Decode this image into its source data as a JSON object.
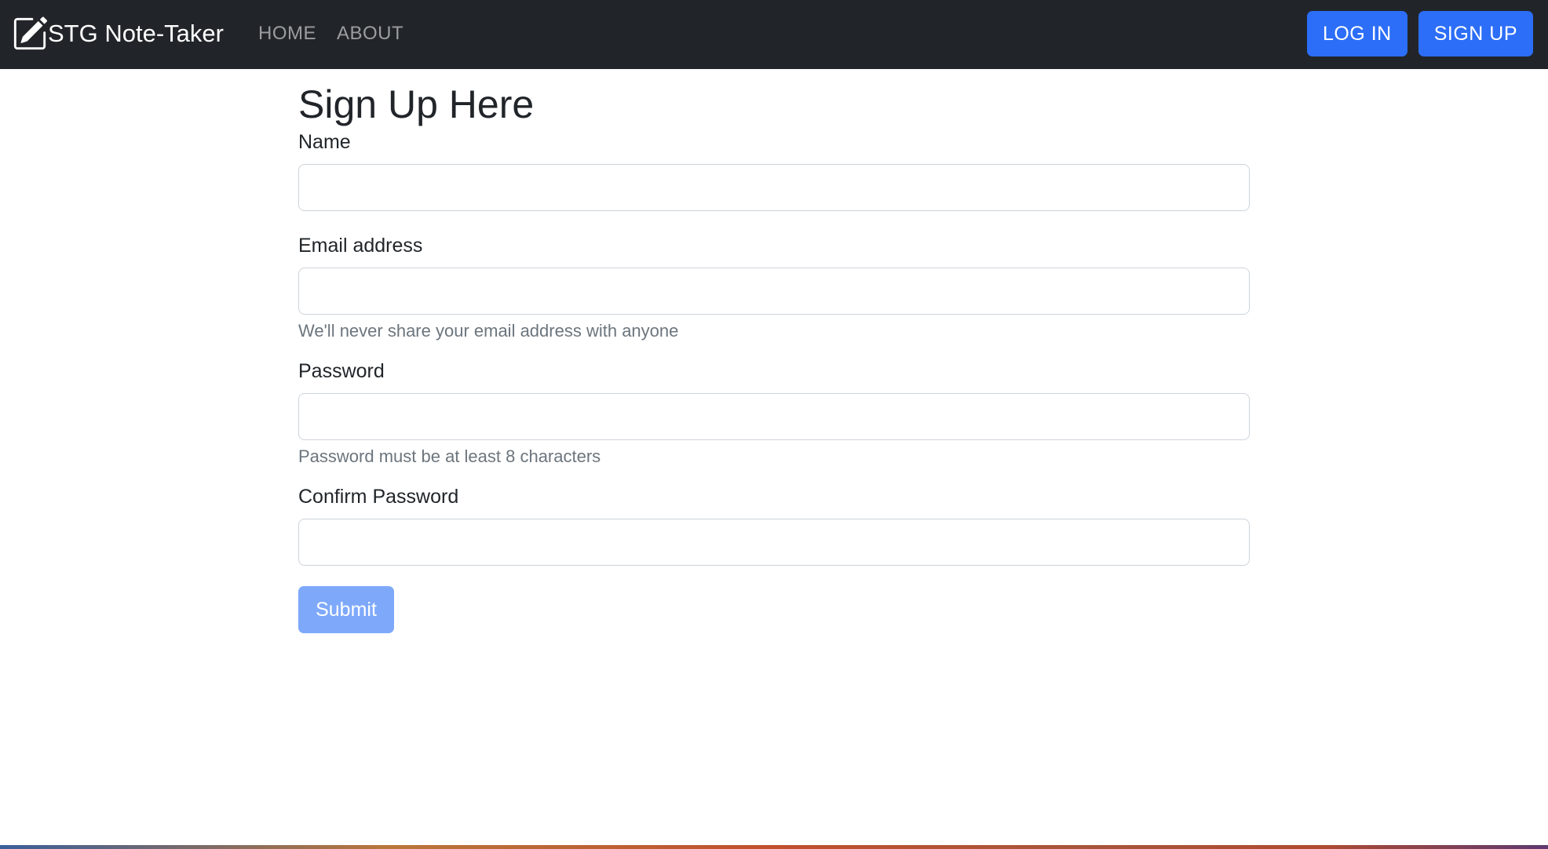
{
  "navbar": {
    "brand_icon": "pencil-square-icon",
    "brand_label": "STG Note-Taker",
    "links": [
      {
        "label": "HOME"
      },
      {
        "label": "ABOUT"
      }
    ],
    "login_label": "LOG IN",
    "signup_label": "SIGN UP"
  },
  "form": {
    "title": "Sign Up Here",
    "name": {
      "label": "Name",
      "value": ""
    },
    "email": {
      "label": "Email address",
      "value": "",
      "help": "We'll never share your email address with anyone"
    },
    "password": {
      "label": "Password",
      "value": "",
      "help": "Password must be at least 8 characters"
    },
    "confirm": {
      "label": "Confirm Password",
      "value": ""
    },
    "submit_label": "Submit"
  },
  "colors": {
    "navbar_bg": "#212529",
    "primary": "#2c6ef7",
    "submit_disabled": "#7ea9fb"
  }
}
